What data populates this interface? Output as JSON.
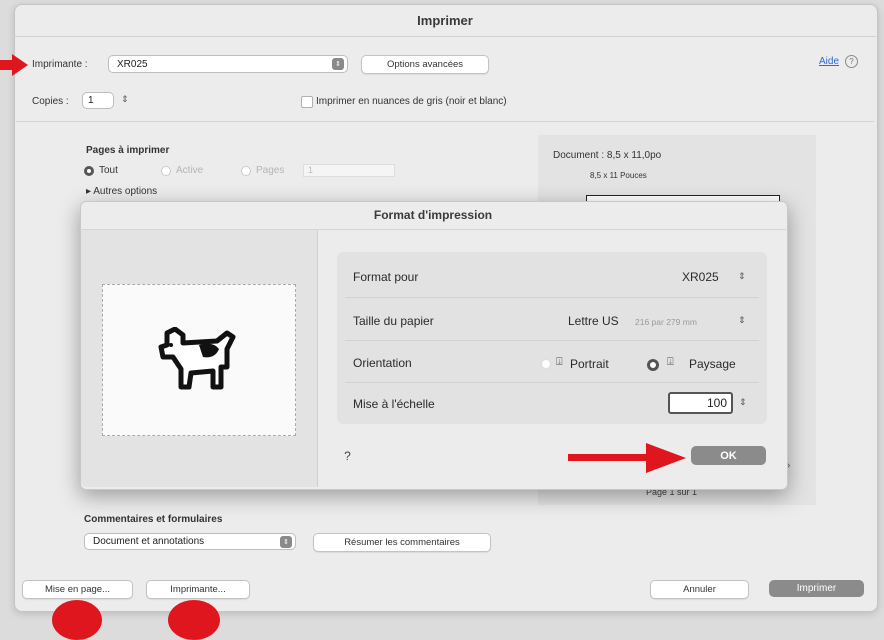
{
  "window": {
    "title": "Imprimer"
  },
  "printer": {
    "label": "Imprimante :",
    "value": "XR025",
    "advanced_button": "Options avancées",
    "help_link": "Aide"
  },
  "copies": {
    "label": "Copies :",
    "value": "1",
    "grayscale_label": "Imprimer en nuances de gris (noir et blanc)"
  },
  "pages": {
    "heading": "Pages à imprimer",
    "options": [
      "Tout",
      "Active",
      "Pages"
    ],
    "pages_value": "1",
    "more_options": "Autres options"
  },
  "document_preview": {
    "size_label": "Document : 8,5 x 11,0po",
    "paper_label": "8,5 x 11 Pouces",
    "page_indicator": "Page 1 sur 1"
  },
  "comments": {
    "heading": "Commentaires et formulaires",
    "select_value": "Document et annotations",
    "summarize_button": "Résumer les commentaires"
  },
  "footer": {
    "page_setup_button": "Mise en page...",
    "printer_button": "Imprimante...",
    "cancel_button": "Annuler",
    "print_button": "Imprimer"
  },
  "sheet": {
    "title": "Format d'impression",
    "format_for_label": "Format pour",
    "format_for_value": "XR025",
    "paper_size_label": "Taille du papier",
    "paper_size_value": "Lettre US",
    "paper_size_dims": "216 par 279 mm",
    "orientation_label": "Orientation",
    "portrait_label": "Portrait",
    "landscape_label": "Paysage",
    "scale_label": "Mise à l'échelle",
    "scale_value": "100",
    "help_glyph": "?",
    "ok_button": "OK"
  },
  "colors": {
    "annotation_red": "#e0161e",
    "default_button": "#8b8b8b"
  }
}
